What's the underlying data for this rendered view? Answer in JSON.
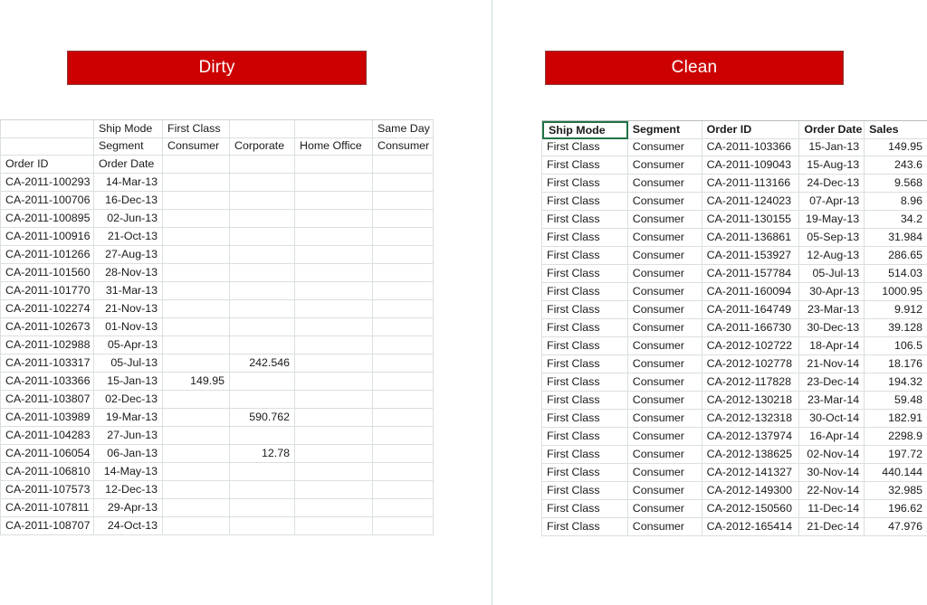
{
  "banners": {
    "left_label": "Dirty",
    "right_label": "Clean",
    "color": "#CC0000",
    "text_color": "#FFFFFF"
  },
  "dirty_table": {
    "name": "Dirty",
    "crosstab_header_rows": [
      [
        "",
        "Ship Mode",
        "First Class",
        "",
        "",
        "Same Day"
      ],
      [
        "",
        "Segment",
        "Consumer",
        "Corporate",
        "Home Office",
        "Consumer"
      ],
      [
        "Order ID",
        "Order Date",
        "",
        "",
        "",
        ""
      ]
    ],
    "rows": [
      [
        "CA-2011-100293",
        "14-Mar-13",
        "",
        "",
        "",
        ""
      ],
      [
        "CA-2011-100706",
        "16-Dec-13",
        "",
        "",
        "",
        ""
      ],
      [
        "CA-2011-100895",
        "02-Jun-13",
        "",
        "",
        "",
        ""
      ],
      [
        "CA-2011-100916",
        "21-Oct-13",
        "",
        "",
        "",
        ""
      ],
      [
        "CA-2011-101266",
        "27-Aug-13",
        "",
        "",
        "",
        ""
      ],
      [
        "CA-2011-101560",
        "28-Nov-13",
        "",
        "",
        "",
        ""
      ],
      [
        "CA-2011-101770",
        "31-Mar-13",
        "",
        "",
        "",
        ""
      ],
      [
        "CA-2011-102274",
        "21-Nov-13",
        "",
        "",
        "",
        ""
      ],
      [
        "CA-2011-102673",
        "01-Nov-13",
        "",
        "",
        "",
        ""
      ],
      [
        "CA-2011-102988",
        "05-Apr-13",
        "",
        "",
        "",
        ""
      ],
      [
        "CA-2011-103317",
        "05-Jul-13",
        "",
        "242.546",
        "",
        ""
      ],
      [
        "CA-2011-103366",
        "15-Jan-13",
        "149.95",
        "",
        "",
        ""
      ],
      [
        "CA-2011-103807",
        "02-Dec-13",
        "",
        "",
        "",
        ""
      ],
      [
        "CA-2011-103989",
        "19-Mar-13",
        "",
        "590.762",
        "",
        ""
      ],
      [
        "CA-2011-104283",
        "27-Jun-13",
        "",
        "",
        "",
        ""
      ],
      [
        "CA-2011-106054",
        "06-Jan-13",
        "",
        "12.78",
        "",
        ""
      ],
      [
        "CA-2011-106810",
        "14-May-13",
        "",
        "",
        "",
        ""
      ],
      [
        "CA-2011-107573",
        "12-Dec-13",
        "",
        "",
        "",
        ""
      ],
      [
        "CA-2011-107811",
        "29-Apr-13",
        "",
        "",
        "",
        ""
      ],
      [
        "CA-2011-108707",
        "24-Oct-13",
        "",
        "",
        "",
        ""
      ]
    ]
  },
  "clean_table": {
    "name": "Clean",
    "columns": [
      "Ship Mode",
      "Segment",
      "Order ID",
      "Order Date",
      "Sales"
    ],
    "active_cell": "Ship Mode",
    "rows": [
      [
        "First Class",
        "Consumer",
        "CA-2011-103366",
        "15-Jan-13",
        "149.95"
      ],
      [
        "First Class",
        "Consumer",
        "CA-2011-109043",
        "15-Aug-13",
        "243.6"
      ],
      [
        "First Class",
        "Consumer",
        "CA-2011-113166",
        "24-Dec-13",
        "9.568"
      ],
      [
        "First Class",
        "Consumer",
        "CA-2011-124023",
        "07-Apr-13",
        "8.96"
      ],
      [
        "First Class",
        "Consumer",
        "CA-2011-130155",
        "19-May-13",
        "34.2"
      ],
      [
        "First Class",
        "Consumer",
        "CA-2011-136861",
        "05-Sep-13",
        "31.984"
      ],
      [
        "First Class",
        "Consumer",
        "CA-2011-153927",
        "12-Aug-13",
        "286.65"
      ],
      [
        "First Class",
        "Consumer",
        "CA-2011-157784",
        "05-Jul-13",
        "514.03"
      ],
      [
        "First Class",
        "Consumer",
        "CA-2011-160094",
        "30-Apr-13",
        "1000.95"
      ],
      [
        "First Class",
        "Consumer",
        "CA-2011-164749",
        "23-Mar-13",
        "9.912"
      ],
      [
        "First Class",
        "Consumer",
        "CA-2011-166730",
        "30-Dec-13",
        "39.128"
      ],
      [
        "First Class",
        "Consumer",
        "CA-2012-102722",
        "18-Apr-14",
        "106.5"
      ],
      [
        "First Class",
        "Consumer",
        "CA-2012-102778",
        "21-Nov-14",
        "18.176"
      ],
      [
        "First Class",
        "Consumer",
        "CA-2012-117828",
        "23-Dec-14",
        "194.32"
      ],
      [
        "First Class",
        "Consumer",
        "CA-2012-130218",
        "23-Mar-14",
        "59.48"
      ],
      [
        "First Class",
        "Consumer",
        "CA-2012-132318",
        "30-Oct-14",
        "182.91"
      ],
      [
        "First Class",
        "Consumer",
        "CA-2012-137974",
        "16-Apr-14",
        "2298.9"
      ],
      [
        "First Class",
        "Consumer",
        "CA-2012-138625",
        "02-Nov-14",
        "197.72"
      ],
      [
        "First Class",
        "Consumer",
        "CA-2012-141327",
        "30-Nov-14",
        "440.144"
      ],
      [
        "First Class",
        "Consumer",
        "CA-2012-149300",
        "22-Nov-14",
        "32.985"
      ],
      [
        "First Class",
        "Consumer",
        "CA-2012-150560",
        "11-Dec-14",
        "196.62"
      ],
      [
        "First Class",
        "Consumer",
        "CA-2012-165414",
        "21-Dec-14",
        "47.976"
      ]
    ]
  }
}
